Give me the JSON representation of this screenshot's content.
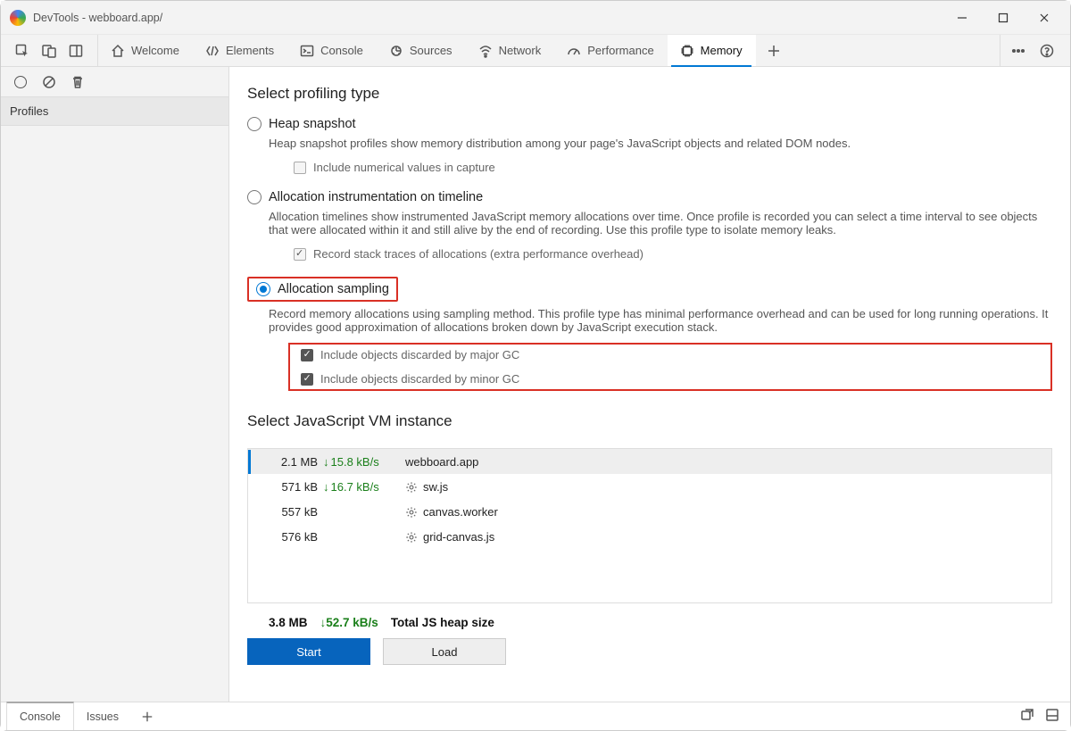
{
  "window": {
    "title": "DevTools - webboard.app/"
  },
  "tabs": {
    "welcome": "Welcome",
    "elements": "Elements",
    "console": "Console",
    "sources": "Sources",
    "network": "Network",
    "performance": "Performance",
    "memory": "Memory"
  },
  "left": {
    "profiles": "Profiles"
  },
  "main": {
    "heading_profiling": "Select profiling type",
    "heap_label": "Heap snapshot",
    "heap_desc": "Heap snapshot profiles show memory distribution among your page's JavaScript objects and related DOM nodes.",
    "heap_cb": "Include numerical values in capture",
    "alloc_label": "Allocation instrumentation on timeline",
    "alloc_desc": "Allocation timelines show instrumented JavaScript memory allocations over time. Once profile is recorded you can select a time interval to see objects that were allocated within it and still alive by the end of recording. Use this profile type to isolate memory leaks.",
    "alloc_cb": "Record stack traces of allocations (extra performance overhead)",
    "samp_label": "Allocation sampling",
    "samp_desc": "Record memory allocations using sampling method. This profile type has minimal performance overhead and can be used for long running operations. It provides good approximation of allocations broken down by JavaScript execution stack.",
    "samp_cb_major": "Include objects discarded by major GC",
    "samp_cb_minor": "Include objects discarded by minor GC",
    "heading_vm": "Select JavaScript VM instance"
  },
  "vm": {
    "rows": [
      {
        "size": "2.1 MB",
        "rate": "15.8 kB/s",
        "name": "webboard.app",
        "hasgear": false
      },
      {
        "size": "571 kB",
        "rate": "16.7 kB/s",
        "name": "sw.js",
        "hasgear": true
      },
      {
        "size": "557 kB",
        "rate": "",
        "name": "canvas.worker",
        "hasgear": true
      },
      {
        "size": "576 kB",
        "rate": "",
        "name": "grid-canvas.js",
        "hasgear": true
      }
    ],
    "total_size": "3.8 MB",
    "total_rate": "52.7 kB/s",
    "total_label": "Total JS heap size"
  },
  "buttons": {
    "start": "Start",
    "load": "Load"
  },
  "footer": {
    "console": "Console",
    "issues": "Issues"
  }
}
